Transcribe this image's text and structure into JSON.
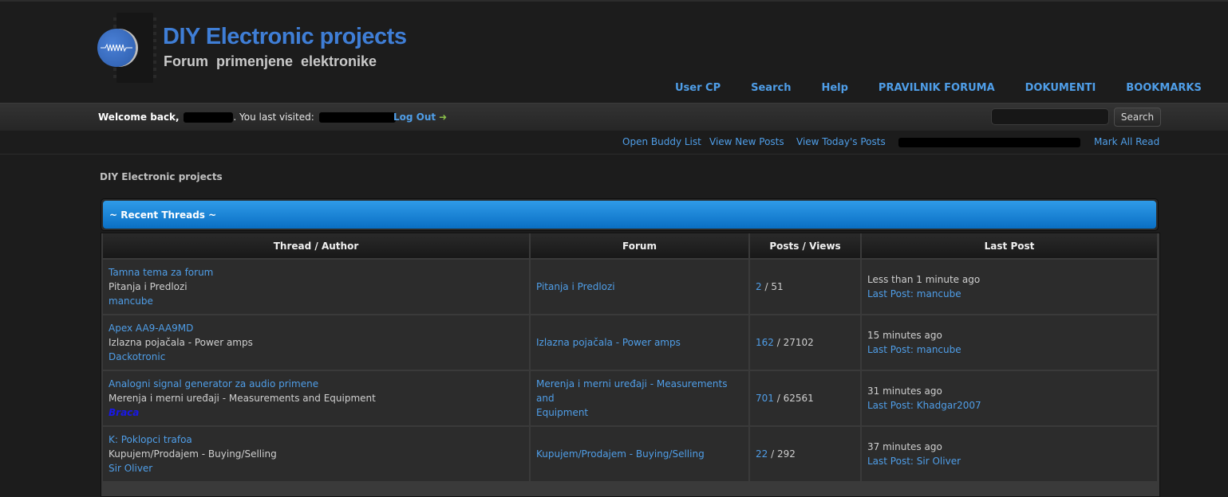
{
  "logo": {
    "title": "DIY Electronic projects",
    "subtitle": "Forum primenjene elektronike",
    "icon": "pulse-circle-icon"
  },
  "nav": [
    "User CP",
    "Search",
    "Help",
    "PRAVILNIK FORUMA",
    "DOKUMENTI",
    "BOOKMARKS"
  ],
  "welcome": {
    "prefix": "Welcome back,",
    "visited": ". You last visited:",
    "logout": "Log Out",
    "logout_icon": "arrow-right-icon"
  },
  "search": {
    "button": "Search",
    "placeholder": ""
  },
  "subnav": [
    "Open Buddy List",
    "View New Posts",
    "View Today's Posts",
    "Mark All Read"
  ],
  "breadcrumb": "DIY Electronic projects",
  "block_title": "~ Recent Threads ~",
  "columns": [
    "Thread / Author",
    "Forum",
    "Posts / Views",
    "Last Post"
  ],
  "threads": [
    {
      "title": "Tamna tema za forum",
      "forum_short": "Pitanja i Predlozi",
      "author": "mancube",
      "forum": "Pitanja i Predlozi",
      "posts": "2",
      "views": "51",
      "time": "Less than 1 minute ago",
      "last_post": "Last Post: mancube"
    },
    {
      "title": "Apex AA9-AA9MD",
      "forum_short": "Izlazna pojačala - Power amps",
      "author": "Dackotronic",
      "forum": "Izlazna pojačala - Power amps",
      "posts": "162",
      "views": "27102",
      "time": "15 minutes ago",
      "last_post": "Last Post: mancube"
    },
    {
      "title": "Analogni signal generator za audio primene",
      "forum_short": "Merenja i merni uređaji - Measurements and Equipment",
      "author": "Braca",
      "forum_l1": "Merenja i merni uređaji - Measurements and",
      "forum_l2": "Equipment",
      "posts": "701",
      "views": "62561",
      "time": "31 minutes ago",
      "last_post": "Last Post: Khadgar2007"
    },
    {
      "title": "K: Poklopci trafoa",
      "forum_short": "Kupujem/Prodajem - Buying/Selling",
      "author": "Sir Oliver",
      "forum": "Kupujem/Prodajem - Buying/Selling",
      "posts": "22",
      "views": "292",
      "time": "37 minutes ago",
      "last_post": "Last Post: Sir Oliver"
    }
  ],
  "colors": {
    "accent": "#4f9ee8",
    "header_blue": "#1b86d9",
    "background": "#1c1c1c",
    "special_author": "#1818e8"
  }
}
